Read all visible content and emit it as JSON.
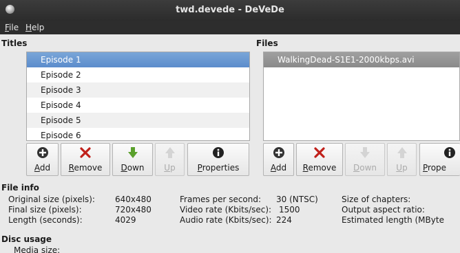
{
  "window": {
    "title": "twd.devede - DeVeDe"
  },
  "menu": {
    "file_first": "F",
    "file_rest": "ile",
    "help_first": "H",
    "help_rest": "elp"
  },
  "titles": {
    "label": "Titles",
    "items": [
      "Episode 1",
      "Episode 2",
      "Episode 3",
      "Episode 4",
      "Episode 5",
      "Episode 6"
    ],
    "buttons": {
      "add": {
        "first": "A",
        "rest": "dd"
      },
      "remove": {
        "first": "R",
        "rest": "emove"
      },
      "down": {
        "first": "D",
        "rest": "own"
      },
      "up": {
        "first": "U",
        "rest": "p"
      },
      "properties": {
        "first": "P",
        "rest": "roperties"
      }
    }
  },
  "files": {
    "label": "Files",
    "items": [
      "WalkingDead-S1E1-2000kbps.avi"
    ],
    "buttons": {
      "add": {
        "first": "A",
        "rest": "dd"
      },
      "remove": {
        "first": "R",
        "rest": "emove"
      },
      "down": {
        "first": "D",
        "rest": "own"
      },
      "up": {
        "first": "U",
        "rest": "p"
      },
      "properties": {
        "first": "P",
        "rest": "rope"
      }
    }
  },
  "file_info": {
    "label": "File info",
    "original_size_label": "Original size (pixels):",
    "original_size_value": "640x480",
    "final_size_label": "Final size (pixels):",
    "final_size_value": "720x480",
    "length_label": "Length (seconds):",
    "length_value": "4029",
    "fps_label": "Frames per second:",
    "fps_value": "30 (NTSC)",
    "video_rate_label": "Video rate (Kbits/sec):",
    "video_rate_value": "1500",
    "audio_rate_label": "Audio rate (Kbits/sec):",
    "audio_rate_value": "224",
    "chapters_label": "Size of chapters:",
    "aspect_label": "Output aspect ratio:",
    "estimated_label": "Estimated length (MByte"
  },
  "disc_usage": {
    "label": "Disc usage",
    "media_size_label": "Media size:"
  },
  "colors": {
    "selection": "#5b8ccc",
    "titlebar": "#2d2d2d",
    "remove": "#c0201a",
    "down": "#5aa02c"
  }
}
